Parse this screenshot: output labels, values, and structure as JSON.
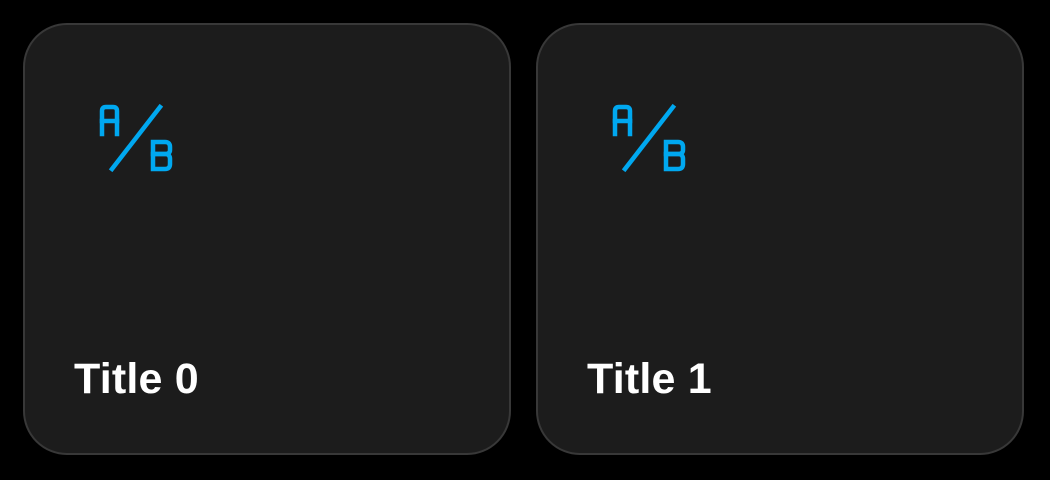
{
  "accent_color": "#00a8f0",
  "cards": [
    {
      "title": "Title 0",
      "icon": "ab-test-icon"
    },
    {
      "title": "Title 1",
      "icon": "ab-test-icon"
    }
  ]
}
